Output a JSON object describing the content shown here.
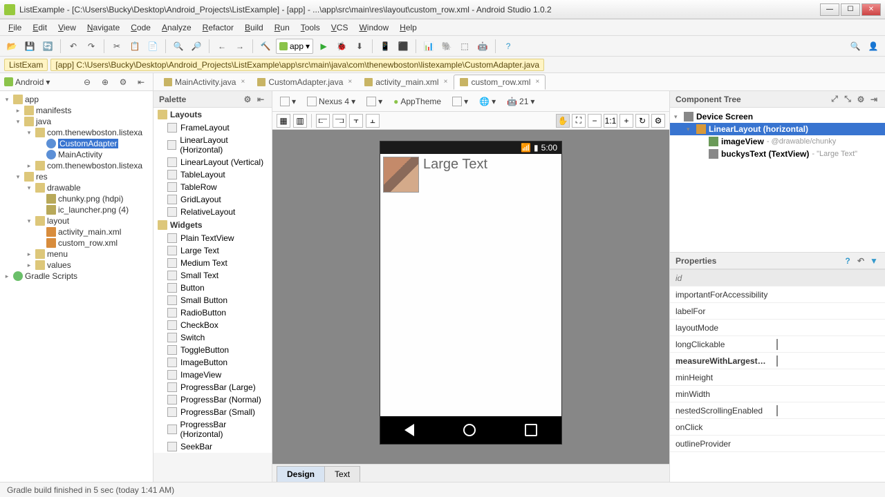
{
  "window": {
    "title": "ListExample - [C:\\Users\\Bucky\\Desktop\\Android_Projects\\ListExample] - [app] - ...\\app\\src\\main\\res\\layout\\custom_row.xml - Android Studio 1.0.2"
  },
  "menu": [
    "File",
    "Edit",
    "View",
    "Navigate",
    "Code",
    "Analyze",
    "Refactor",
    "Build",
    "Run",
    "Tools",
    "VCS",
    "Window",
    "Help"
  ],
  "run_config": "app",
  "breadcrumb": {
    "chip": "ListExam",
    "path": "[app] C:\\Users\\Bucky\\Desktop\\Android_Projects\\ListExample\\app\\src\\main\\java\\com\\thenewboston\\listexample\\CustomAdapter.java"
  },
  "nav_combo": "Android",
  "tabs": [
    {
      "label": "MainActivity.java",
      "active": false
    },
    {
      "label": "CustomAdapter.java",
      "active": false
    },
    {
      "label": "activity_main.xml",
      "active": false
    },
    {
      "label": "custom_row.xml",
      "active": true
    }
  ],
  "project_tree": [
    {
      "depth": 0,
      "exp": "▾",
      "icon": "folder",
      "label": "app"
    },
    {
      "depth": 1,
      "exp": "▸",
      "icon": "folder",
      "label": "manifests"
    },
    {
      "depth": 1,
      "exp": "▾",
      "icon": "folder",
      "label": "java"
    },
    {
      "depth": 2,
      "exp": "▾",
      "icon": "folder",
      "label": "com.thenewboston.listexa"
    },
    {
      "depth": 3,
      "exp": "",
      "icon": "java",
      "label": "CustomAdapter",
      "selected": true
    },
    {
      "depth": 3,
      "exp": "",
      "icon": "java",
      "label": "MainActivity"
    },
    {
      "depth": 2,
      "exp": "▸",
      "icon": "folder",
      "label": "com.thenewboston.listexa"
    },
    {
      "depth": 1,
      "exp": "▾",
      "icon": "folder",
      "label": "res"
    },
    {
      "depth": 2,
      "exp": "▾",
      "icon": "folder",
      "label": "drawable"
    },
    {
      "depth": 3,
      "exp": "",
      "icon": "png",
      "label": "chunky.png (hdpi)"
    },
    {
      "depth": 3,
      "exp": "",
      "icon": "png",
      "label": "ic_launcher.png (4)"
    },
    {
      "depth": 2,
      "exp": "▾",
      "icon": "folder",
      "label": "layout"
    },
    {
      "depth": 3,
      "exp": "",
      "icon": "xml",
      "label": "activity_main.xml"
    },
    {
      "depth": 3,
      "exp": "",
      "icon": "xml",
      "label": "custom_row.xml"
    },
    {
      "depth": 2,
      "exp": "▸",
      "icon": "folder",
      "label": "menu"
    },
    {
      "depth": 2,
      "exp": "▸",
      "icon": "folder",
      "label": "values"
    },
    {
      "depth": 0,
      "exp": "▸",
      "icon": "gradle",
      "label": "Gradle Scripts"
    }
  ],
  "palette_header": "Palette",
  "palette": {
    "Layouts": [
      "FrameLayout",
      "LinearLayout (Horizontal)",
      "LinearLayout (Vertical)",
      "TableLayout",
      "TableRow",
      "GridLayout",
      "RelativeLayout"
    ],
    "Widgets": [
      "Plain TextView",
      "Large Text",
      "Medium Text",
      "Small Text",
      "Button",
      "Small Button",
      "RadioButton",
      "CheckBox",
      "Switch",
      "ToggleButton",
      "ImageButton",
      "ImageView",
      "ProgressBar (Large)",
      "ProgressBar (Normal)",
      "ProgressBar (Small)",
      "ProgressBar (Horizontal)",
      "SeekBar"
    ]
  },
  "designer_toolbar": {
    "device": "Nexus 4",
    "theme": "AppTheme",
    "api": "21"
  },
  "preview": {
    "time": "5:00",
    "text": "Large Text"
  },
  "bottom_tabs": [
    "Design",
    "Text"
  ],
  "component_tree_header": "Component Tree",
  "component_tree": [
    {
      "depth": 0,
      "exp": "▾",
      "icon": "device",
      "label": "Device Screen"
    },
    {
      "depth": 1,
      "exp": "▾",
      "icon": "linear",
      "label": "LinearLayout (horizontal)",
      "selected": true
    },
    {
      "depth": 2,
      "exp": "",
      "icon": "image",
      "label": "imageView",
      "meta": " - @drawable/chunky"
    },
    {
      "depth": 2,
      "exp": "",
      "icon": "text",
      "label": "buckysText (TextView)",
      "meta": " - \"Large Text\""
    }
  ],
  "properties_header": "Properties",
  "properties": [
    {
      "key": "id",
      "header": true
    },
    {
      "key": "importantForAccessibility"
    },
    {
      "key": "labelFor"
    },
    {
      "key": "layoutMode"
    },
    {
      "key": "longClickable",
      "check": true
    },
    {
      "key": "measureWithLargestCh",
      "check": true,
      "bold": true
    },
    {
      "key": "minHeight"
    },
    {
      "key": "minWidth"
    },
    {
      "key": "nestedScrollingEnabled",
      "check": true
    },
    {
      "key": "onClick"
    },
    {
      "key": "outlineProvider"
    }
  ],
  "status": "Gradle build finished in 5 sec (today 1:41 AM)"
}
